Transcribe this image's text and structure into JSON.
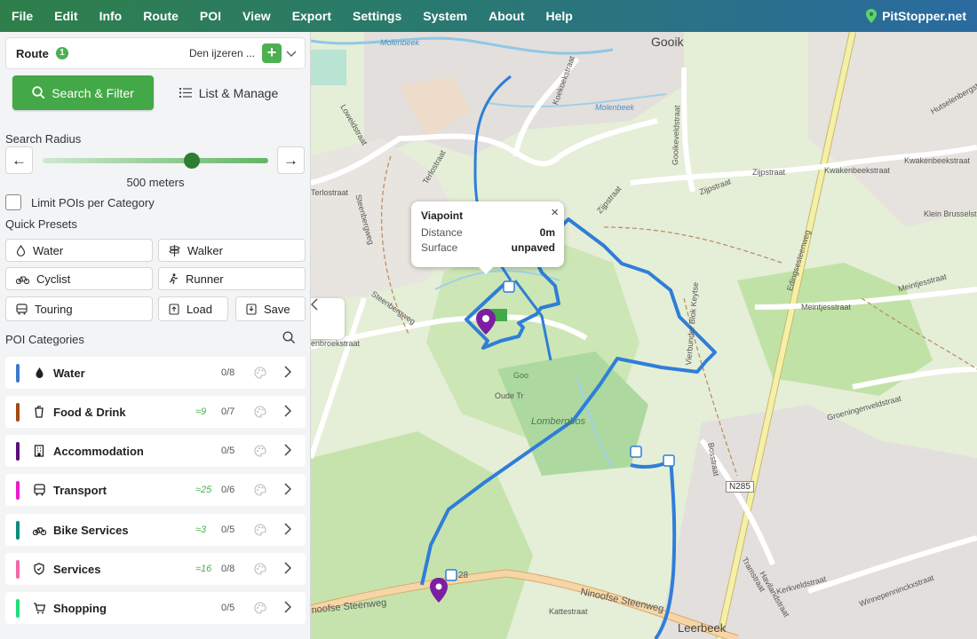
{
  "menu": [
    "File",
    "Edit",
    "Info",
    "Route",
    "POI",
    "View",
    "Export",
    "Settings",
    "System",
    "About",
    "Help"
  ],
  "brand": "PitStopper.net",
  "route": {
    "label": "Route",
    "count": "1",
    "name": "Den ijzeren ...",
    "add_symbol": "+"
  },
  "tabs": {
    "search": "Search & Filter",
    "list": "List & Manage"
  },
  "search_radius": {
    "title": "Search Radius",
    "value": "500 meters",
    "left_arrow": "←",
    "right_arrow": "→",
    "level_fraction": 0.66
  },
  "limit_label": "Limit POIs per Category",
  "presets_title": "Quick Presets",
  "presets": {
    "water": "Water",
    "walker": "Walker",
    "cyclist": "Cyclist",
    "runner": "Runner",
    "touring": "Touring",
    "load": "Load",
    "save": "Save"
  },
  "categories_title": "POI Categories",
  "categories": [
    {
      "label": "Water",
      "approx": "",
      "count": "0/8",
      "color": "#3d7ac9"
    },
    {
      "label": "Food & Drink",
      "approx": "≈9",
      "count": "0/7",
      "color": "#a34a12"
    },
    {
      "label": "Accommodation",
      "approx": "",
      "count": "0/5",
      "color": "#5a0f7a"
    },
    {
      "label": "Transport",
      "approx": "≈25",
      "count": "0/6",
      "color": "#e91ec8"
    },
    {
      "label": "Bike Services",
      "approx": "≈3",
      "count": "0/5",
      "color": "#108a7a"
    },
    {
      "label": "Services",
      "approx": "≈16",
      "count": "0/8",
      "color": "#f06aa8"
    },
    {
      "label": "Shopping",
      "approx": "",
      "count": "0/5",
      "color": "#1ee07a"
    }
  ],
  "popup": {
    "title": "Viapoint",
    "distance_label": "Distance",
    "distance_value": "0m",
    "surface_label": "Surface",
    "surface_value": "unpaved",
    "close": "×"
  },
  "map_labels": {
    "gooik": "Gooik",
    "molenbeek1": "Molenbeek",
    "molenbeek2": "Molenbeek",
    "koekoekstraat": "Koekoekstraat",
    "gooikeveldstraat": "Gooikeveldstraat",
    "zijpstraat1": "Zijpstraat",
    "zijpstraat2": "Zijpstraat",
    "zijpstraat3": "Zijpstraat",
    "kwakenbeekstraat1": "Kwakenbeekstraat",
    "kwakenbeekstraat2": "Kwakenbeekstraat",
    "hutselenbergstraat": "Hutselenbergstraat",
    "kleinbrussel": "Klein Brusselstr",
    "edingsesteenweg": "Edingsesteenweg",
    "meintjesstraat1": "Meintjesstraat",
    "meintjesstraat2": "Meintjesstraat",
    "vierbunder": "Vierbunder Blok Keytse",
    "groeningenveld": "Groeningenveldstraat",
    "terlostraat1": "Terlostraat",
    "terlostraat2": "Terlostraat",
    "loweidstraat": "Loweidstraat",
    "steenbergweg1": "Steenbergweg",
    "steenbergweg2": "Steenbergweg",
    "lombergbos": "Lombergbos",
    "oude": "Oude Tr",
    "roenbroekstraat": "enbroekstraat",
    "bosstraat": "Bosstraat",
    "n285": "N285",
    "kerkveldstraat": "Kerkveldstraat",
    "tramstraat": "Tramstraat",
    "havilandstraat": "Havilandstraat",
    "winnepenninck": "Winnepenninckxstraat",
    "ninoofse1": "Ninoofse Steenweg",
    "ninoofse2": "noofse Steenweg",
    "kattestraat": "Kattestraat",
    "leerbeek": "Leerbeek",
    "route28": "28",
    "goo": "Goo"
  }
}
